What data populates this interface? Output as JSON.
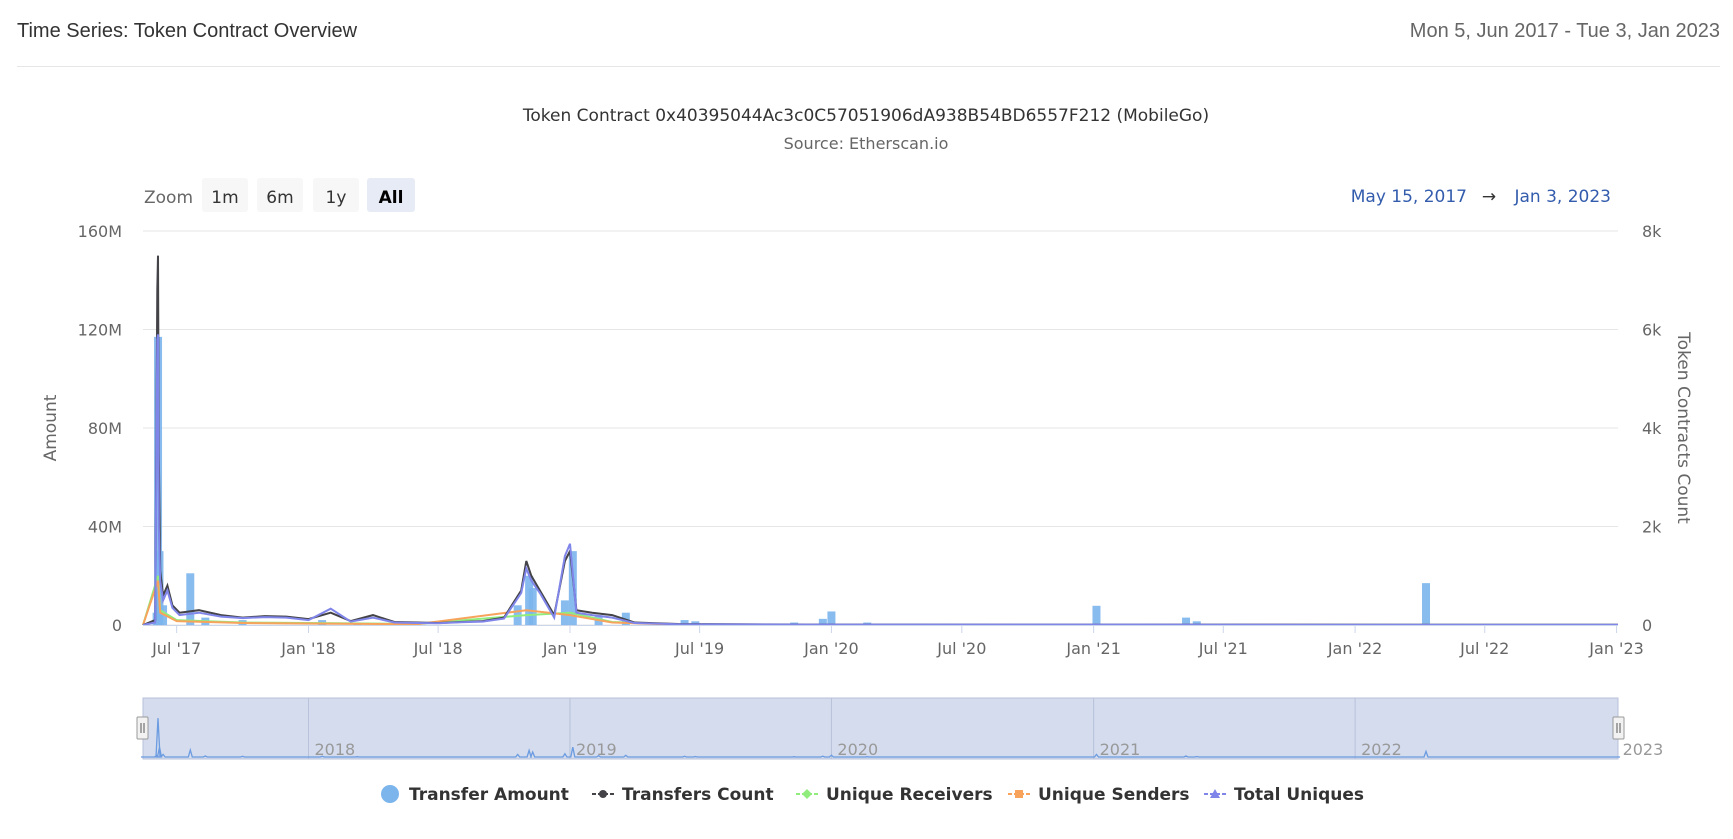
{
  "header": {
    "title": "Time Series: Token Contract Overview",
    "date_range": "Mon 5, Jun 2017 - Tue 3, Jan 2023"
  },
  "range_selector": {
    "zoom_label": "Zoom",
    "buttons": [
      "1m",
      "6m",
      "1y",
      "All"
    ],
    "active": "All",
    "from": "May 15, 2017",
    "arrow": "→",
    "to": "Jan 3, 2023"
  },
  "chart_data": {
    "type": "bar",
    "title": "Token Contract 0x40395044Ac3c0C57051906dA938B54BD6557F212 (MobileGo)",
    "subtitle": "Source: Etherscan.io",
    "ylabel": "Amount",
    "y2label": "Token Contracts Count",
    "ylim": [
      0,
      160000000
    ],
    "y2lim": [
      0,
      8000
    ],
    "xlim": [
      "2017-05-15",
      "2023-01-03"
    ],
    "y_ticks": [
      "0",
      "40M",
      "80M",
      "120M",
      "160M"
    ],
    "y2_ticks": [
      "0",
      "2k",
      "4k",
      "6k",
      "8k"
    ],
    "x_ticks": [
      {
        "date": "2017-07-01",
        "label": "Jul '17"
      },
      {
        "date": "2018-01-01",
        "label": "Jan '18"
      },
      {
        "date": "2018-07-01",
        "label": "Jul '18"
      },
      {
        "date": "2019-01-01",
        "label": "Jan '19"
      },
      {
        "date": "2019-07-01",
        "label": "Jul '19"
      },
      {
        "date": "2020-01-01",
        "label": "Jan '20"
      },
      {
        "date": "2020-07-01",
        "label": "Jul '20"
      },
      {
        "date": "2021-01-01",
        "label": "Jan '21"
      },
      {
        "date": "2021-07-01",
        "label": "Jul '21"
      },
      {
        "date": "2022-01-01",
        "label": "Jan '22"
      },
      {
        "date": "2022-07-01",
        "label": "Jul '22"
      },
      {
        "date": "2023-01-01",
        "label": "Jan '23"
      }
    ],
    "legend_position": "bottom",
    "series": [
      {
        "name": "Transfer Amount",
        "type": "column",
        "axis": "left",
        "color": "#7cb5ec",
        "points": [
          [
            "2017-06-03",
            5000000
          ],
          [
            "2017-06-05",
            117000000
          ],
          [
            "2017-06-07",
            30000000
          ],
          [
            "2017-06-12",
            8000000
          ],
          [
            "2017-07-20",
            21000000
          ],
          [
            "2017-08-10",
            3000000
          ],
          [
            "2017-10-01",
            2000000
          ],
          [
            "2018-01-20",
            2000000
          ],
          [
            "2018-03-10",
            1000000
          ],
          [
            "2018-10-20",
            8000000
          ],
          [
            "2018-11-05",
            20000000
          ],
          [
            "2018-11-10",
            15000000
          ],
          [
            "2018-12-25",
            10000000
          ],
          [
            "2019-01-05",
            30000000
          ],
          [
            "2019-02-10",
            4000000
          ],
          [
            "2019-03-20",
            5000000
          ],
          [
            "2019-06-10",
            2000000
          ],
          [
            "2019-06-25",
            1500000
          ],
          [
            "2019-11-10",
            1000000
          ],
          [
            "2019-12-20",
            2500000
          ],
          [
            "2020-01-01",
            5500000
          ],
          [
            "2020-02-20",
            1000000
          ],
          [
            "2021-01-05",
            7800000
          ],
          [
            "2021-05-10",
            3000000
          ],
          [
            "2021-05-25",
            1500000
          ],
          [
            "2022-04-10",
            17000000
          ]
        ]
      },
      {
        "name": "Transfers Count",
        "type": "line",
        "axis": "right",
        "color": "#434348",
        "points": [
          [
            "2017-05-15",
            0
          ],
          [
            "2017-06-01",
            100
          ],
          [
            "2017-06-04",
            6800
          ],
          [
            "2017-06-05",
            7500
          ],
          [
            "2017-06-06",
            3500
          ],
          [
            "2017-06-08",
            1100
          ],
          [
            "2017-06-12",
            600
          ],
          [
            "2017-06-18",
            800
          ],
          [
            "2017-06-25",
            400
          ],
          [
            "2017-07-05",
            250
          ],
          [
            "2017-08-01",
            300
          ],
          [
            "2017-09-01",
            200
          ],
          [
            "2017-10-01",
            150
          ],
          [
            "2017-11-01",
            180
          ],
          [
            "2017-12-01",
            170
          ],
          [
            "2018-01-01",
            120
          ],
          [
            "2018-02-01",
            250
          ],
          [
            "2018-03-01",
            80
          ],
          [
            "2018-04-01",
            200
          ],
          [
            "2018-05-01",
            60
          ],
          [
            "2018-06-01",
            50
          ],
          [
            "2018-07-01",
            40
          ],
          [
            "2018-08-01",
            60
          ],
          [
            "2018-09-01",
            80
          ],
          [
            "2018-10-01",
            150
          ],
          [
            "2018-10-25",
            700
          ],
          [
            "2018-11-01",
            1300
          ],
          [
            "2018-11-08",
            1000
          ],
          [
            "2018-11-20",
            700
          ],
          [
            "2018-12-10",
            200
          ],
          [
            "2018-12-25",
            1300
          ],
          [
            "2019-01-01",
            1500
          ],
          [
            "2019-01-10",
            300
          ],
          [
            "2019-02-01",
            250
          ],
          [
            "2019-03-01",
            200
          ],
          [
            "2019-04-01",
            50
          ],
          [
            "2019-06-01",
            20
          ],
          [
            "2019-12-01",
            10
          ],
          [
            "2023-01-03",
            5
          ]
        ]
      },
      {
        "name": "Unique Receivers",
        "type": "line",
        "axis": "right",
        "color": "#90ed7d",
        "points": [
          [
            "2017-05-15",
            0
          ],
          [
            "2017-06-05",
            1000
          ],
          [
            "2017-06-08",
            300
          ],
          [
            "2017-07-01",
            100
          ],
          [
            "2017-10-01",
            50
          ],
          [
            "2018-01-01",
            40
          ],
          [
            "2018-06-01",
            20
          ],
          [
            "2018-11-01",
            200
          ],
          [
            "2019-01-01",
            250
          ],
          [
            "2019-03-01",
            60
          ],
          [
            "2019-06-01",
            10
          ],
          [
            "2023-01-03",
            2
          ]
        ]
      },
      {
        "name": "Unique Senders",
        "type": "line",
        "axis": "right",
        "color": "#f7a35c",
        "points": [
          [
            "2017-05-15",
            0
          ],
          [
            "2017-06-05",
            900
          ],
          [
            "2017-06-08",
            250
          ],
          [
            "2017-07-01",
            80
          ],
          [
            "2017-10-01",
            40
          ],
          [
            "2018-01-01",
            30
          ],
          [
            "2018-06-01",
            15
          ],
          [
            "2018-11-01",
            300
          ],
          [
            "2019-01-01",
            200
          ],
          [
            "2019-03-01",
            50
          ],
          [
            "2019-06-01",
            8
          ],
          [
            "2023-01-03",
            2
          ]
        ]
      },
      {
        "name": "Total Uniques",
        "type": "line",
        "axis": "right",
        "color": "#8085e9",
        "points": [
          [
            "2017-05-15",
            0
          ],
          [
            "2017-06-01",
            50
          ],
          [
            "2017-06-04",
            5800
          ],
          [
            "2017-06-05",
            5900
          ],
          [
            "2017-06-06",
            2000
          ],
          [
            "2017-06-08",
            900
          ],
          [
            "2017-06-12",
            500
          ],
          [
            "2017-06-18",
            700
          ],
          [
            "2017-06-25",
            350
          ],
          [
            "2017-07-05",
            200
          ],
          [
            "2017-08-01",
            250
          ],
          [
            "2017-09-01",
            170
          ],
          [
            "2017-10-01",
            140
          ],
          [
            "2017-11-01",
            160
          ],
          [
            "2017-12-01",
            150
          ],
          [
            "2018-01-01",
            100
          ],
          [
            "2018-02-01",
            330
          ],
          [
            "2018-03-01",
            70
          ],
          [
            "2018-04-01",
            150
          ],
          [
            "2018-05-01",
            50
          ],
          [
            "2018-06-01",
            40
          ],
          [
            "2018-07-01",
            35
          ],
          [
            "2018-08-01",
            55
          ],
          [
            "2018-09-01",
            70
          ],
          [
            "2018-10-01",
            130
          ],
          [
            "2018-10-25",
            650
          ],
          [
            "2018-11-01",
            1150
          ],
          [
            "2018-11-08",
            900
          ],
          [
            "2018-11-20",
            650
          ],
          [
            "2018-12-10",
            150
          ],
          [
            "2018-12-25",
            1400
          ],
          [
            "2019-01-01",
            1650
          ],
          [
            "2019-01-10",
            250
          ],
          [
            "2019-02-01",
            200
          ],
          [
            "2019-03-01",
            150
          ],
          [
            "2019-04-01",
            40
          ],
          [
            "2019-06-01",
            15
          ],
          [
            "2019-12-01",
            8
          ],
          [
            "2023-01-03",
            4
          ]
        ]
      }
    ],
    "navigator": {
      "year_labels": [
        {
          "date": "2018-01-01",
          "label": "2018"
        },
        {
          "date": "2019-01-01",
          "label": "2019"
        },
        {
          "date": "2020-01-01",
          "label": "2020"
        },
        {
          "date": "2021-01-01",
          "label": "2021"
        },
        {
          "date": "2022-01-01",
          "label": "2022"
        },
        {
          "date": "2023-01-01",
          "label": "2023"
        }
      ],
      "selected_from": "2017-05-15",
      "selected_to": "2023-01-03"
    }
  }
}
